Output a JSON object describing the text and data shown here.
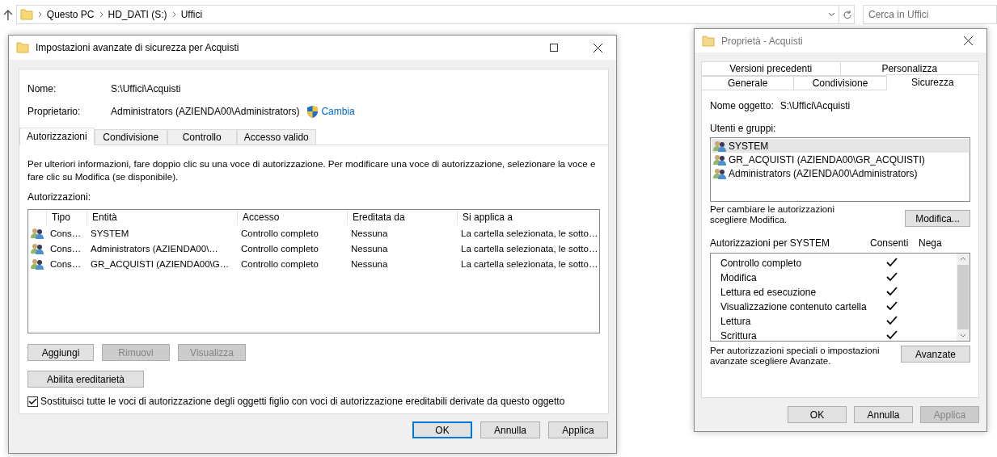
{
  "explorer": {
    "breadcrumb": [
      "Questo PC",
      "HD_DATI (S:)",
      "Uffici"
    ],
    "search": {
      "placeholder": "Cerca in Uffici"
    }
  },
  "advanced_dialog": {
    "title": "Impostazioni avanzate di sicurezza per Acquisti",
    "fields": [
      {
        "label": "Nome:",
        "value": "S:\\Uffici\\Acquisti"
      },
      {
        "label": "Proprietario:",
        "value": "Administrators (AZIENDA00\\Administrators)",
        "link": "Cambia"
      }
    ],
    "tabs": [
      {
        "label": "Autorizzazioni",
        "selected": true
      },
      {
        "label": "Condivisione",
        "selected": false
      },
      {
        "label": "Controllo",
        "selected": false
      },
      {
        "label": "Accesso valido",
        "selected": false
      }
    ],
    "description": "Per ulteriori informazioni, fare doppio clic su una voce di autorizzazione. Per modificare una voce di autorizzazione, selezionare la voce e fare clic su Modifica (se disponibile).",
    "list_label": "Autorizzazioni:",
    "columns": [
      "Tipo",
      "Entità",
      "Accesso",
      "Ereditata da",
      "Si applica a"
    ],
    "rows": [
      [
        "Cons…",
        "SYSTEM",
        "Controllo completo",
        "Nessuna",
        "La cartella selezionata, le sotto…"
      ],
      [
        "Cons…",
        "Administrators (AZIENDA00\\…",
        "Controllo completo",
        "Nessuna",
        "La cartella selezionata, le sotto…"
      ],
      [
        "Cons…",
        "GR_ACQUISTI (AZIENDA00\\G…",
        "Controllo completo",
        "Nessuna",
        "La cartella selezionata, le sotto…"
      ]
    ],
    "buttons": [
      {
        "label": "Aggiungi",
        "disabled": false
      },
      {
        "label": "Rimuovi",
        "disabled": true
      },
      {
        "label": "Visualizza",
        "disabled": true
      }
    ],
    "inherit_button": "Abilita ereditarietà",
    "replace_checkbox": {
      "label": "Sostituisci tutte le voci di autorizzazione degli oggetti figlio con voci di autorizzazione ereditabili derivate da questo oggetto",
      "checked": true
    },
    "footer_buttons": [
      {
        "label": "OK",
        "default": true,
        "disabled": false
      },
      {
        "label": "Annulla",
        "default": false,
        "disabled": false
      },
      {
        "label": "Applica",
        "default": false,
        "disabled": false
      }
    ]
  },
  "properties_dialog": {
    "title": "Proprietà - Acquisti",
    "tab_rows": [
      [
        {
          "label": "Versioni precedenti",
          "selected": false
        },
        {
          "label": "Personalizza",
          "selected": false
        }
      ],
      [
        {
          "label": "Generale",
          "selected": false
        },
        {
          "label": "Condivisione",
          "selected": false
        },
        {
          "label": "Sicurezza",
          "selected": true
        }
      ]
    ],
    "object_label": "Nome oggetto:",
    "object_value": "S:\\Uffici\\Acquisti",
    "users_label": "Utenti e gruppi:",
    "users": [
      {
        "name": "SYSTEM",
        "selected": true
      },
      {
        "name": "GR_ACQUISTI (AZIENDA00\\GR_ACQUISTI)",
        "selected": false
      },
      {
        "name": "Administrators (AZIENDA00\\Administrators)",
        "selected": false
      }
    ],
    "change_note": "Per cambiare le autorizzazioni scegliere Modifica.",
    "change_button": "Modifica...",
    "permissions_label": "Autorizzazioni per SYSTEM",
    "allow_header": "Consenti",
    "deny_header": "Nega",
    "permissions": [
      {
        "name": "Controllo completo",
        "allow": true,
        "deny": false
      },
      {
        "name": "Modifica",
        "allow": true,
        "deny": false
      },
      {
        "name": "Lettura ed esecuzione",
        "allow": true,
        "deny": false
      },
      {
        "name": "Visualizzazione contenuto cartella",
        "allow": true,
        "deny": false
      },
      {
        "name": "Lettura",
        "allow": true,
        "deny": false
      },
      {
        "name": "Scrittura",
        "allow": true,
        "deny": false
      }
    ],
    "advanced_note": "Per autorizzazioni speciali o impostazioni avanzate scegliere Avanzate.",
    "advanced_button": "Avanzate",
    "footer_buttons": [
      {
        "label": "OK",
        "default": false,
        "disabled": false
      },
      {
        "label": "Annulla",
        "default": false,
        "disabled": false
      },
      {
        "label": "Applica",
        "default": false,
        "disabled": true
      }
    ]
  }
}
